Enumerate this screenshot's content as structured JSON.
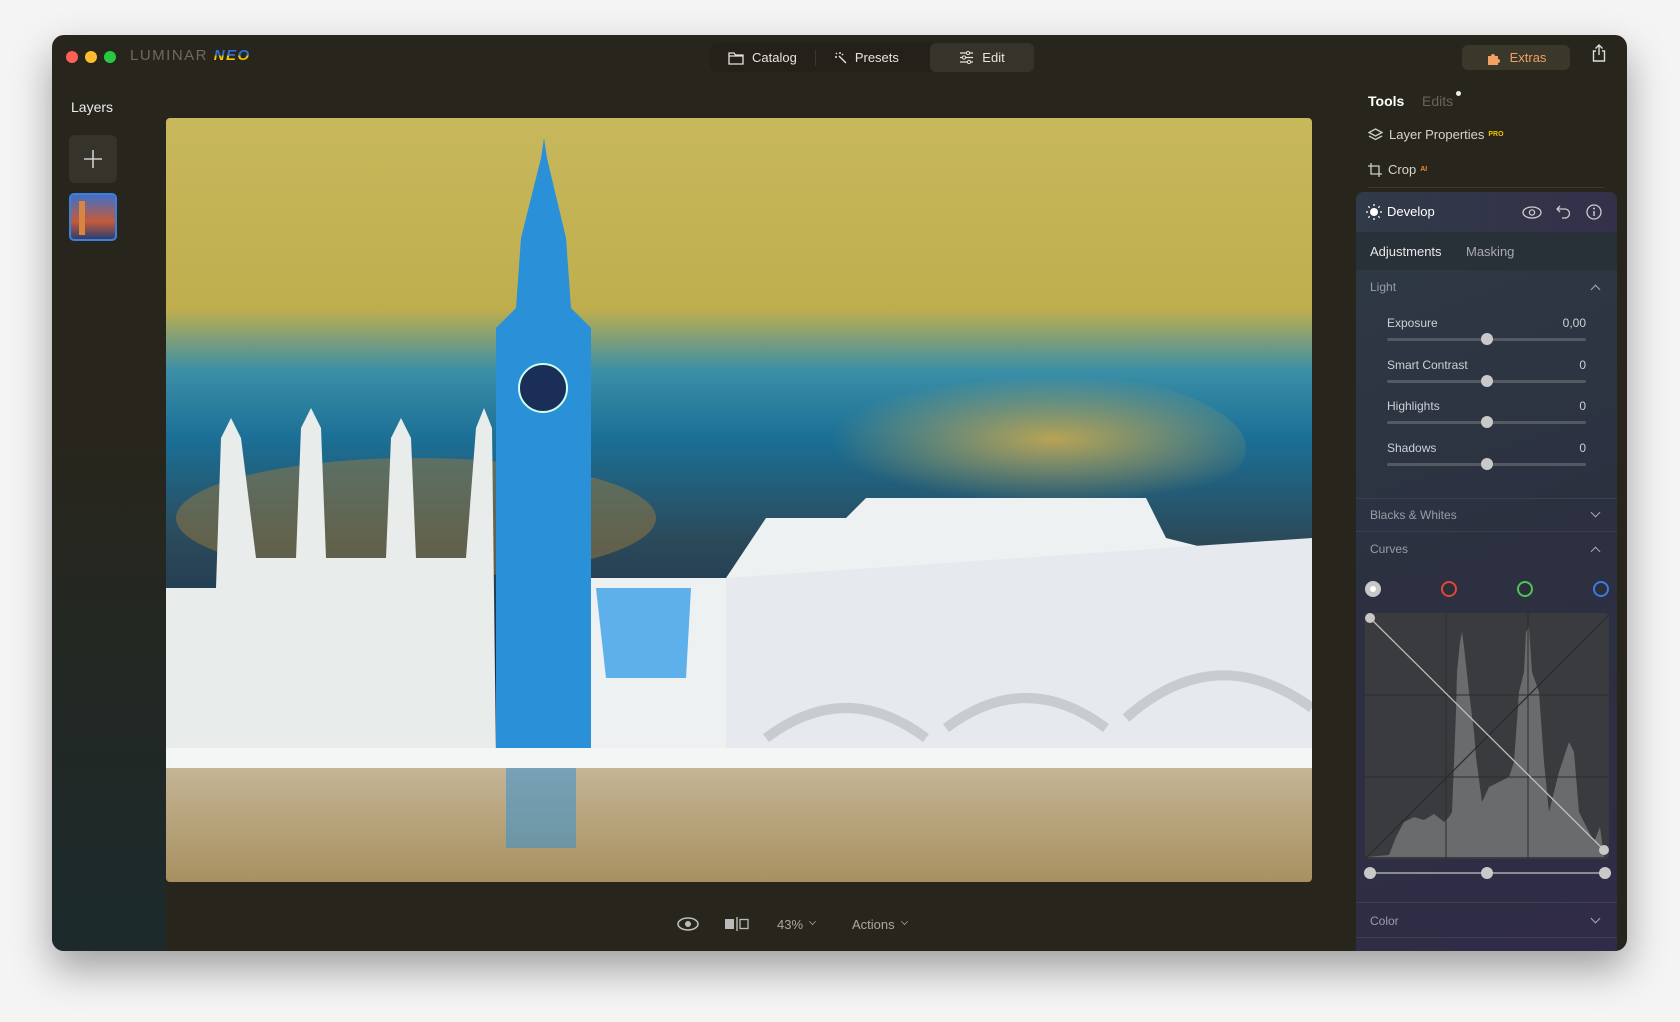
{
  "app": {
    "logo_text": "LUMINAR NEO"
  },
  "nav": {
    "tabs": [
      {
        "label": "Catalog",
        "icon": "folder-icon"
      },
      {
        "label": "Presets",
        "icon": "magic-wand-icon"
      },
      {
        "label": "Edit",
        "icon": "sliders-icon",
        "active": true
      }
    ]
  },
  "header": {
    "extras_label": "Extras",
    "share_icon": "share-icon"
  },
  "layers": {
    "title": "Layers",
    "add_icon": "plus-icon"
  },
  "bottom": {
    "zoom": "43%",
    "actions": "Actions"
  },
  "tools": {
    "tab_tools": "Tools",
    "tab_edits": "Edits",
    "layer_properties": "Layer Properties",
    "layer_properties_badge": "PRO",
    "crop": "Crop",
    "crop_badge": "AI"
  },
  "develop": {
    "title": "Develop",
    "tab_adjustments": "Adjustments",
    "tab_masking": "Masking",
    "light": {
      "title": "Light",
      "sliders": [
        {
          "label": "Exposure",
          "value": "0,00",
          "level": 0.5
        },
        {
          "label": "Smart Contrast",
          "value": "0",
          "level": 0.5
        },
        {
          "label": "Highlights",
          "value": "0",
          "level": 0.5
        },
        {
          "label": "Shadows",
          "value": "0",
          "level": 0.5
        }
      ]
    },
    "blacks_whites": "Blacks & Whites",
    "curves": {
      "title": "Curves",
      "channels": [
        "#c8c8c8",
        "#e0463a",
        "#4cc45a",
        "#3a7ae8"
      ]
    },
    "color": "Color"
  },
  "colors": {
    "accent_extras": "#f0a060",
    "badge_pro": "#f2c500",
    "badge_ai": "#f08a2a"
  }
}
